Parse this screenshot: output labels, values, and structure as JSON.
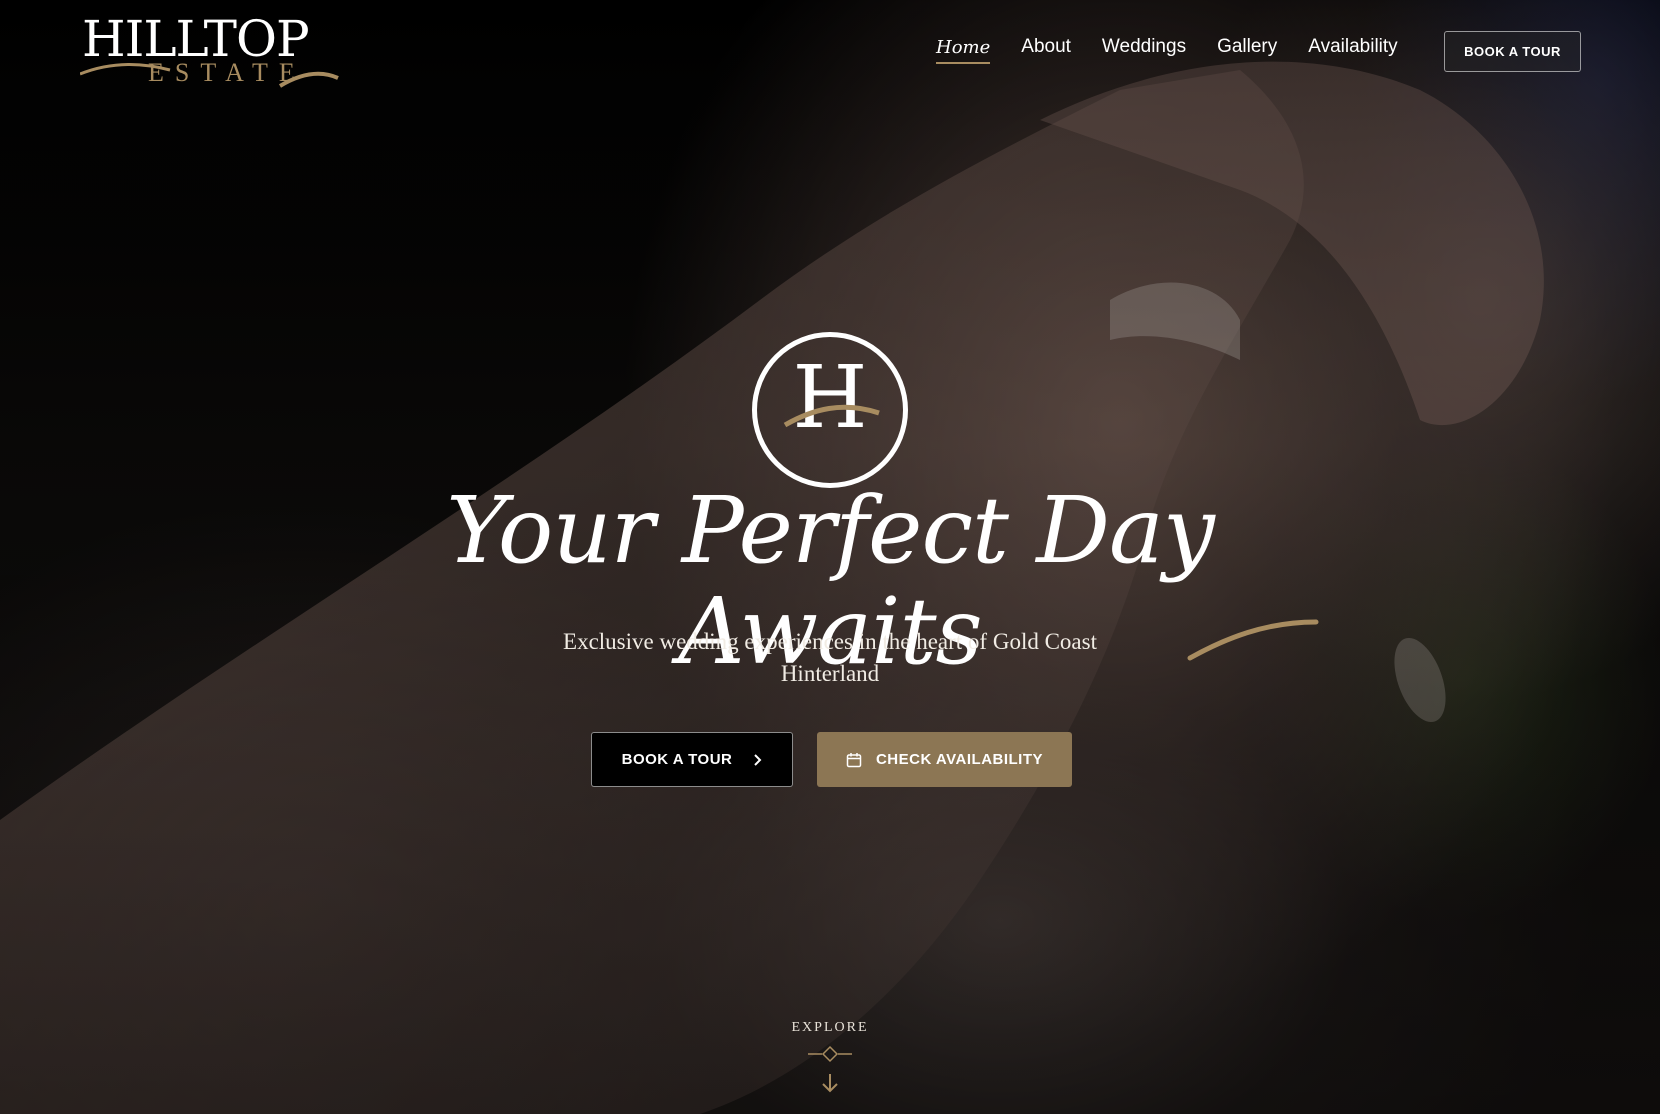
{
  "brand": {
    "logo_main": "HILLTOP",
    "logo_sub": "ESTATE",
    "emblem_letter": "H",
    "accent_color": "#a88c60"
  },
  "nav": {
    "items": [
      {
        "label": "Home",
        "active": true
      },
      {
        "label": "About",
        "active": false
      },
      {
        "label": "Weddings",
        "active": false
      },
      {
        "label": "Gallery",
        "active": false
      },
      {
        "label": "Availability",
        "active": false
      }
    ],
    "cta_label": "BOOK A TOUR"
  },
  "hero": {
    "title": "Your Perfect Day Awaits",
    "subtitle": "Exclusive wedding experiences in the heart of Gold Coast Hinterland",
    "primary_button": {
      "label": "BOOK A TOUR",
      "icon": "chevron-right-icon"
    },
    "secondary_button": {
      "label": "CHECK AVAILABILITY",
      "icon": "calendar-icon",
      "color": "#8c7654"
    }
  },
  "scroll_hint": {
    "label": "EXPLORE",
    "icon": "arrow-down-icon"
  }
}
